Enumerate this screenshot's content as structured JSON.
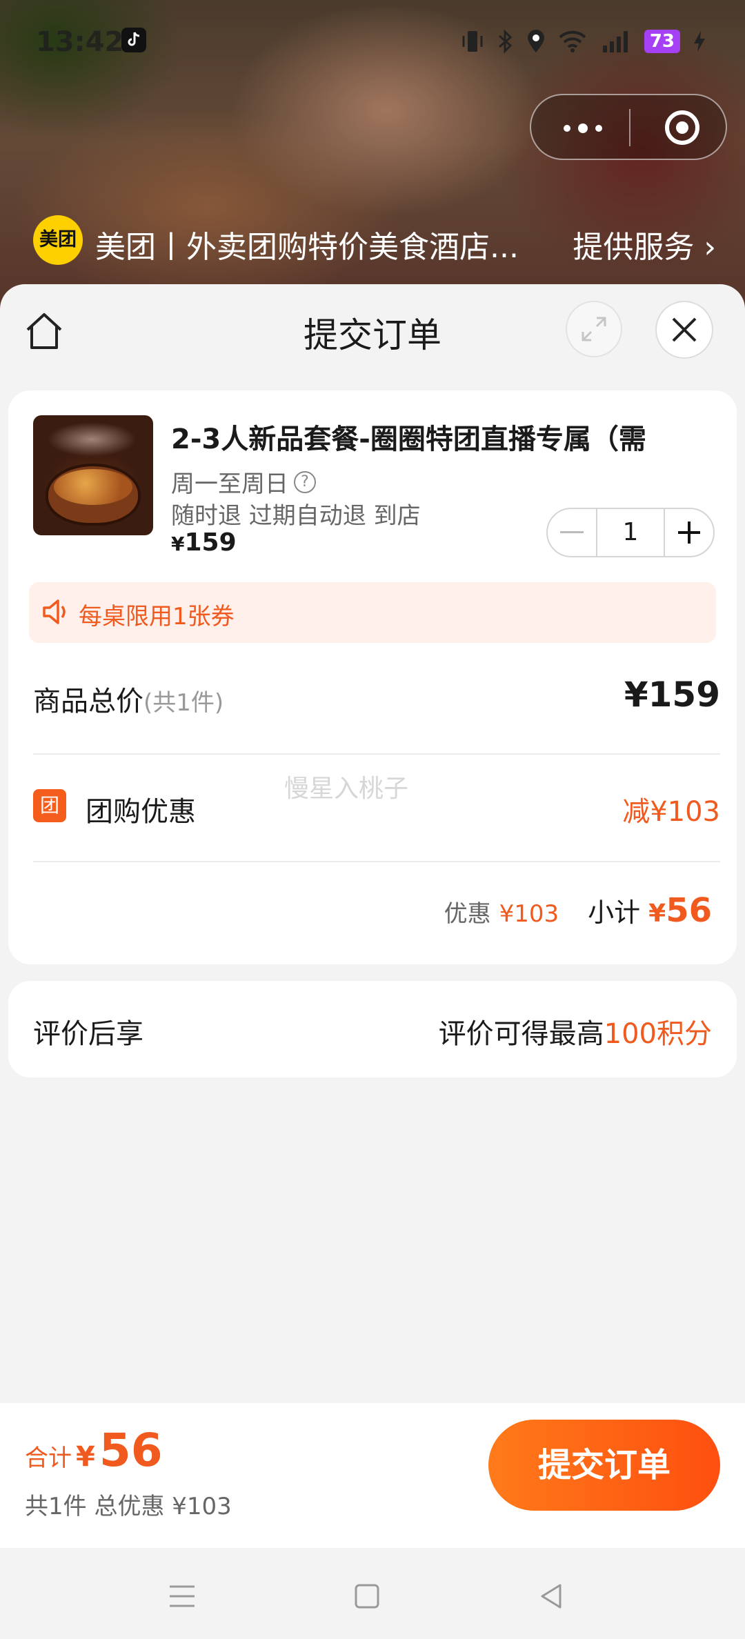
{
  "status_bar": {
    "time": "13:42",
    "battery": "73"
  },
  "mini_program": {
    "logo_text": "美团",
    "name": "美团丨外卖团购特价美食酒店...",
    "service_link": "提供服务"
  },
  "sheet": {
    "title": "提交订单"
  },
  "product": {
    "title": "2-3人新品套餐-圈圈特团直播专属（需",
    "days": "周一至周日",
    "policy": "随时退 过期自动退 到店",
    "price_symbol": "¥",
    "price": "159",
    "quantity": "1"
  },
  "notice": {
    "text": "每桌限用1张券"
  },
  "summary": {
    "total_label": "商品总价",
    "total_count": "(共1件)",
    "total_amount": "¥159",
    "discount_icon": "团",
    "discount_label": "团购优惠",
    "discount_amount": "减¥103",
    "watermark": "慢星入桃子",
    "saving_label": "优惠",
    "saving_amount": "¥103",
    "subtotal_label": "小计",
    "subtotal_symbol": "¥",
    "subtotal_value": "56"
  },
  "review": {
    "label": "评价后享",
    "info_prefix": "评价可得最高",
    "info_highlight": "100积分"
  },
  "bottom_bar": {
    "total_label": "合计",
    "total_symbol": "¥",
    "total_value": "56",
    "summary": "共1件 总优惠 ¥103",
    "submit_label": "提交订单"
  },
  "colors": {
    "accent": "#f05a1e",
    "brand_yellow": "#ffd000",
    "battery": "#a540f5"
  }
}
